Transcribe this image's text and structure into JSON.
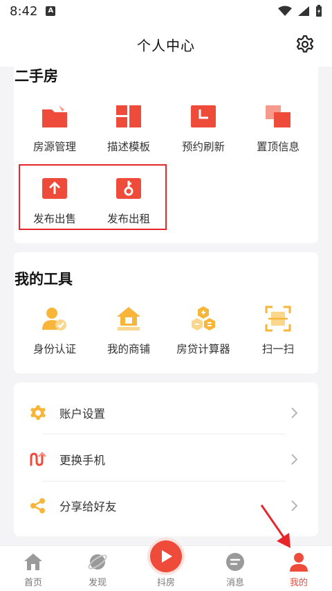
{
  "status_bar": {
    "time": "8:42",
    "notif_letter": "A"
  },
  "header": {
    "title": "个人中心"
  },
  "second_hand": {
    "title": "二手房",
    "items": [
      {
        "label": "房源管理",
        "icon": "folder-icon"
      },
      {
        "label": "描述模板",
        "icon": "template-grid-icon"
      },
      {
        "label": "预约刷新",
        "icon": "clock-icon"
      },
      {
        "label": "置顶信息",
        "icon": "pin-top-icon"
      },
      {
        "label": "发布出售",
        "icon": "upload-icon"
      },
      {
        "label": "发布出租",
        "icon": "key-icon"
      }
    ]
  },
  "tools": {
    "title": "我的工具",
    "items": [
      {
        "label": "身份认证",
        "icon": "identity-verify-icon"
      },
      {
        "label": "我的商铺",
        "icon": "shop-house-icon"
      },
      {
        "label": "房贷计算器",
        "icon": "calculator-icon"
      },
      {
        "label": "扫一扫",
        "icon": "scan-icon"
      }
    ]
  },
  "settings_list": [
    {
      "label": "账户设置",
      "icon": "gear-icon"
    },
    {
      "label": "更换手机",
      "icon": "phone-swap-icon"
    },
    {
      "label": "分享给好友",
      "icon": "share-icon"
    }
  ],
  "tabs": [
    {
      "label": "首页",
      "icon": "home-icon"
    },
    {
      "label": "发现",
      "icon": "discover-planet-icon"
    },
    {
      "label": "抖房",
      "icon": "play-icon"
    },
    {
      "label": "消息",
      "icon": "message-icon"
    },
    {
      "label": "我的",
      "icon": "profile-icon",
      "active": true
    }
  ],
  "colors": {
    "accent": "#ef4b3a",
    "tool_accent": "#f7b53a",
    "highlight": "#e8262a"
  }
}
